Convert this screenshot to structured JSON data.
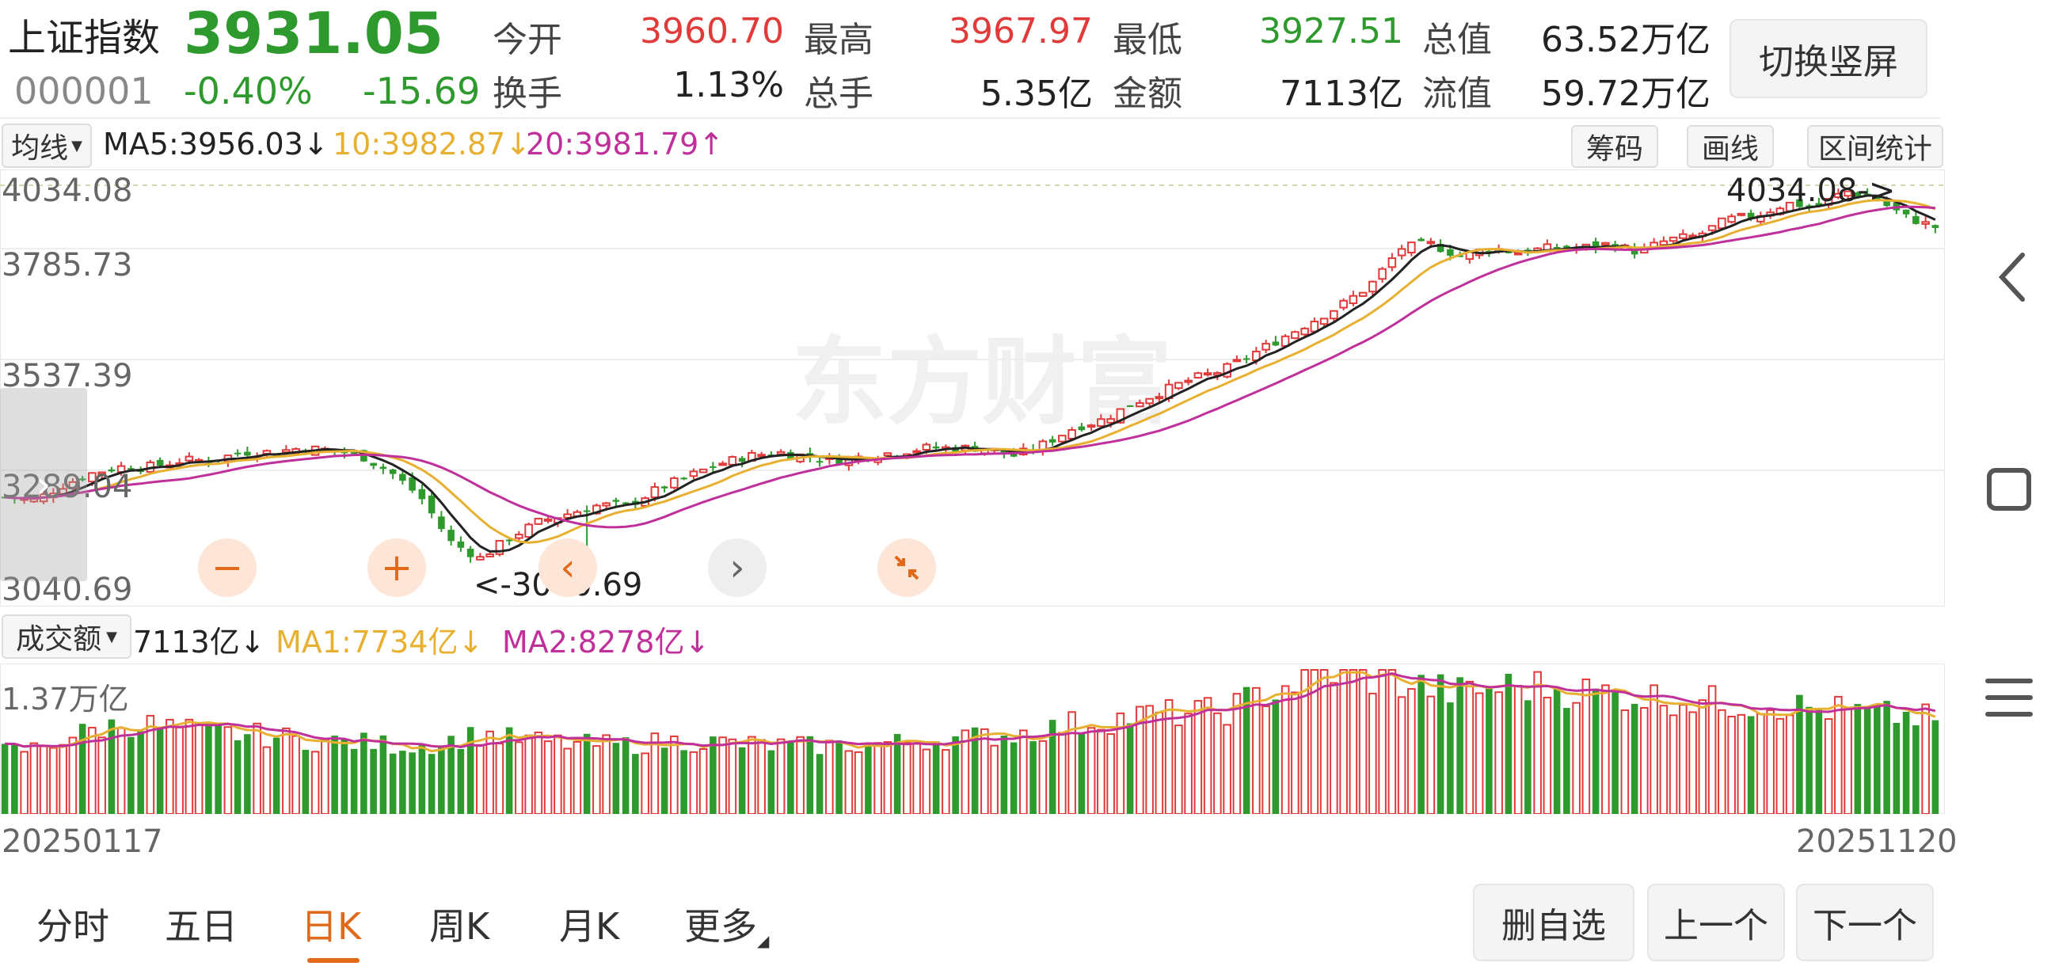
{
  "header": {
    "name": "上证指数",
    "price": "3931.05",
    "code": "000001",
    "change_pct": "-0.40%",
    "change": "-15.69",
    "stats": [
      {
        "label": "今开",
        "value": "3960.70",
        "color": "red"
      },
      {
        "label": "最高",
        "value": "3967.97",
        "color": "red"
      },
      {
        "label": "最低",
        "value": "3927.51",
        "color": "green"
      },
      {
        "label": "总值",
        "value": "63.52万亿",
        "color": "dark"
      },
      {
        "label": "换手",
        "value": "1.13%",
        "color": "dark"
      },
      {
        "label": "总手",
        "value": "5.35亿",
        "color": "dark"
      },
      {
        "label": "金额",
        "value": "7113亿",
        "color": "dark"
      },
      {
        "label": "流值",
        "value": "59.72万亿",
        "color": "dark"
      }
    ],
    "switch_button": "切换竖屏"
  },
  "kline_bar": {
    "indicator": "均线",
    "ma5": "MA5:3956.03↓",
    "ma10": "10:3982.87↓",
    "ma20": "20:3981.79↑",
    "btn_chips": "筹码",
    "btn_draw": "画线",
    "btn_range": "区间统计"
  },
  "kline": {
    "y_labels": [
      "4034.08",
      "3785.73",
      "3537.39",
      "3289.04",
      "3040.69"
    ],
    "max_label": "4034.08->",
    "min_label": "<-3040.69",
    "watermark": "东方财富",
    "ylim": [
      3040.69,
      4034.08
    ]
  },
  "volume_bar": {
    "indicator": "成交额",
    "current": "7113亿↓",
    "ma1": "MA1:7734亿↓",
    "ma2": "MA2:8278亿↓",
    "max_label": "1.37万亿"
  },
  "dates": {
    "start": "20250117",
    "end": "20251120"
  },
  "tabs": [
    "分时",
    "五日",
    "日K",
    "周K",
    "月K",
    "更多"
  ],
  "active_tab": "日K",
  "bottom_buttons": {
    "remove": "删自选",
    "prev": "上一个",
    "next": "下一个"
  },
  "colors": {
    "up": "#e03a3a",
    "down": "#2e9a2e",
    "ma5": "#222222",
    "ma10": "#e8b030",
    "ma20": "#c0309a",
    "accent": "#e06a1a"
  },
  "icons": [
    "chevron-left-icon",
    "square-icon",
    "menu-icon",
    "minus-icon",
    "plus-icon",
    "arrow-left-icon",
    "arrow-right-icon",
    "collapse-icon"
  ],
  "chart_data": {
    "type": "candlestick",
    "x_range": [
      "20250117",
      "20251120"
    ],
    "ylim": [
      3040.69,
      4034.08
    ],
    "close_path": [
      3270,
      3262,
      3300,
      3330,
      3345,
      3345,
      3360,
      3360,
      3380,
      3380,
      3390,
      3385,
      3370,
      3330,
      3270,
      3160,
      3120,
      3170,
      3210,
      3230,
      3250,
      3250,
      3290,
      3320,
      3350,
      3370,
      3380,
      3370,
      3360,
      3370,
      3380,
      3390,
      3390,
      3390,
      3370,
      3400,
      3440,
      3460,
      3500,
      3530,
      3560,
      3580,
      3620,
      3660,
      3700,
      3740,
      3790,
      3880,
      3890,
      3860,
      3880,
      3870,
      3880,
      3880,
      3890,
      3870,
      3900,
      3910,
      3950,
      3960,
      3990,
      3980,
      4020,
      4000,
      3956,
      3931
    ],
    "volume_path": [
      600,
      620,
      720,
      800,
      860,
      840,
      800,
      770,
      760,
      740,
      700,
      690,
      680,
      660,
      650,
      700,
      760,
      720,
      690,
      670,
      660,
      660,
      680,
      690,
      680,
      660,
      650,
      650,
      650,
      660,
      680,
      700,
      720,
      740,
      760,
      800,
      860,
      880,
      930,
      950,
      960,
      970,
      1100,
      1200,
      1300,
      1370,
      1300,
      1250,
      1200,
      1150,
      1200,
      1220,
      1200,
      1170,
      1150,
      1120,
      1100,
      1080,
      1050,
      1050,
      1040,
      1000,
      980,
      950,
      930,
      900
    ]
  }
}
